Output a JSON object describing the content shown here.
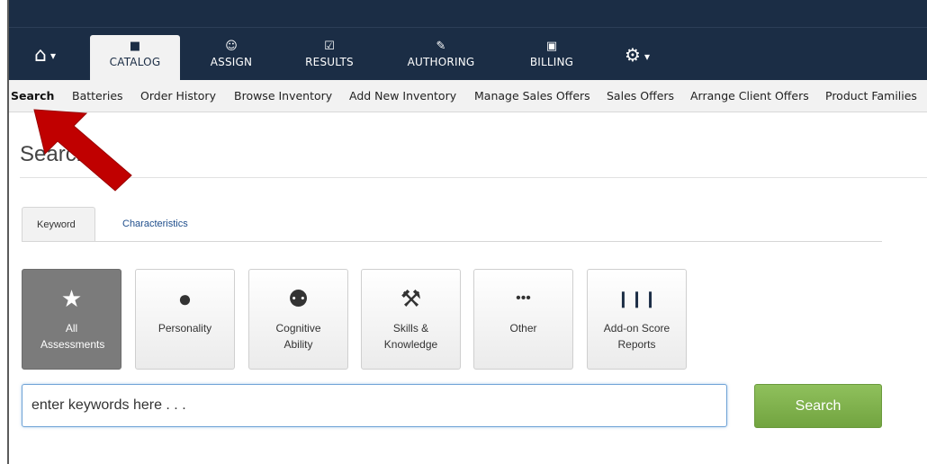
{
  "nav": {
    "items": [
      {
        "label": "CATALOG",
        "icon": "book-icon",
        "glyph": "■"
      },
      {
        "label": "ASSIGN",
        "icon": "users-icon",
        "glyph": "☺"
      },
      {
        "label": "RESULTS",
        "icon": "check-square-icon",
        "glyph": "☑"
      },
      {
        "label": "AUTHORING",
        "icon": "pencil-icon",
        "glyph": "✎"
      },
      {
        "label": "BILLING",
        "icon": "money-icon",
        "glyph": "▣"
      }
    ],
    "active": "CATALOG",
    "home_glyph": "⌂",
    "gear_glyph": "⚙",
    "caret_glyph": "▾"
  },
  "subnav": {
    "items": [
      "Search",
      "Batteries",
      "Order History",
      "Browse Inventory",
      "Add New Inventory",
      "Manage Sales Offers",
      "Sales Offers",
      "Arrange Client Offers",
      "Product Families"
    ],
    "active": "Search"
  },
  "page": {
    "title": "Search"
  },
  "tabs": {
    "items": [
      "Keyword",
      "Characteristics"
    ],
    "active": "Keyword"
  },
  "categories": [
    {
      "label": "All Assessments",
      "icon": "star-icon",
      "glyph": "★",
      "active": true
    },
    {
      "label": "Personality",
      "icon": "user-icon",
      "glyph": "●",
      "active": false
    },
    {
      "label": "Cognitive Ability",
      "icon": "lightbulb-icon",
      "glyph": "⚉",
      "active": false
    },
    {
      "label": "Skills & Knowledge",
      "icon": "wrench-icon",
      "glyph": "⚒",
      "active": false
    },
    {
      "label": "Other",
      "icon": "ellipsis-icon",
      "glyph": "•••",
      "active": false
    },
    {
      "label": "Add-on Score Reports",
      "icon": "bar-chart-icon",
      "glyph": "❙❙❙",
      "active": false
    }
  ],
  "search": {
    "placeholder": "enter keywords here . . .",
    "value": "",
    "button_label": "Search"
  },
  "colors": {
    "nav_bg": "#1b2d45",
    "accent_green": "#7db04a",
    "annotation_arrow": "#c00000"
  }
}
